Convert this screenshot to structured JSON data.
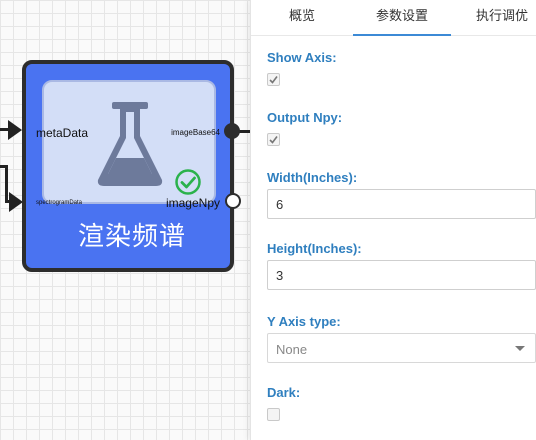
{
  "tabs": [
    {
      "label": "概览"
    },
    {
      "label": "参数设置"
    },
    {
      "label": "执行调优"
    }
  ],
  "active_tab_index": 1,
  "node": {
    "title": "渲染频谱",
    "inputs": {
      "meta": "metaData",
      "spectrogram": "spectrogramData"
    },
    "outputs": {
      "base64": "imageBase64",
      "npy": "imageNpy"
    },
    "icon": "flask-icon",
    "status_icon": "check-circle-icon",
    "colors": {
      "body": "#4a73f1",
      "status": "#2bb24c"
    }
  },
  "form": {
    "show_axis": {
      "label": "Show Axis:",
      "checked": true
    },
    "output_npy": {
      "label": "Output Npy:",
      "checked": true
    },
    "width": {
      "label": "Width(Inches):",
      "value": "6"
    },
    "height": {
      "label": "Height(Inches):",
      "value": "3"
    },
    "y_axis_type": {
      "label": "Y Axis type:",
      "value": "None"
    },
    "dark": {
      "label": "Dark:",
      "checked": false
    }
  }
}
